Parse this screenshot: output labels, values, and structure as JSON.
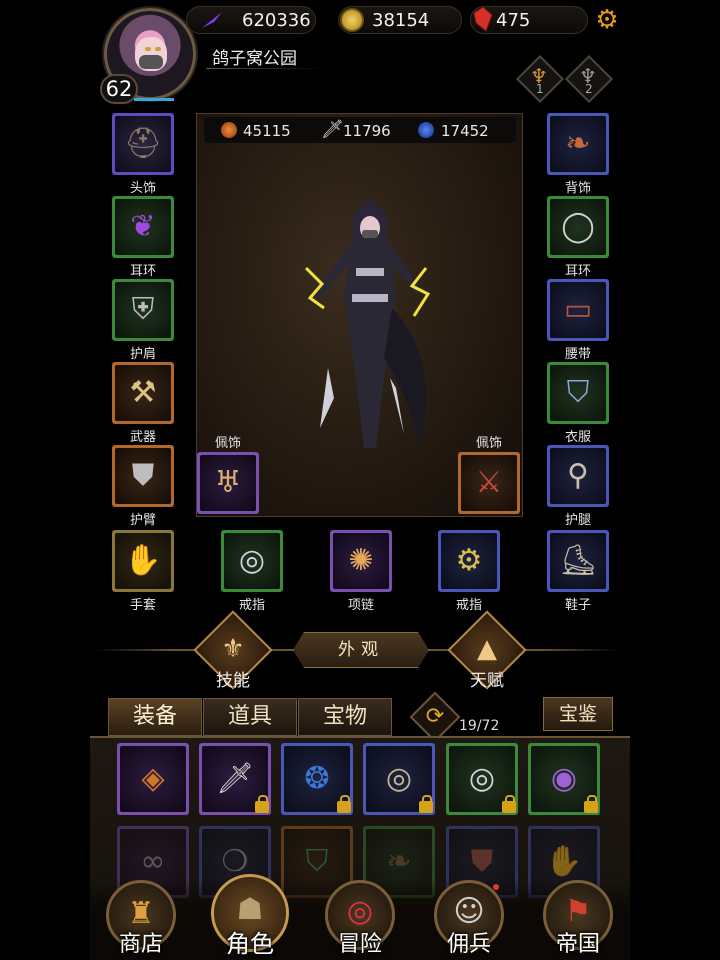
{
  "player": {
    "level": "62",
    "location": "鸽子窝公园"
  },
  "resources": [
    {
      "name": "power",
      "icon": "purple-blade-icon",
      "value": "620336",
      "color": "#8a3cf0"
    },
    {
      "name": "coin",
      "icon": "gold-coin-icon",
      "value": "38154",
      "color": "#d6a21a"
    },
    {
      "name": "gem",
      "icon": "red-crystal-icon",
      "value": "475",
      "color": "#d6302a"
    }
  ],
  "ranks": [
    {
      "label": "1",
      "color": "#d69a2a"
    },
    {
      "label": "2",
      "color": "#8a8a8a"
    }
  ],
  "stats": [
    {
      "icon": "orange-orb-icon",
      "value": "45115",
      "color": "#d8641e"
    },
    {
      "icon": "sword-icon",
      "value": "11796",
      "color": "#cfcfcf"
    },
    {
      "icon": "blue-orb-icon",
      "value": "17452",
      "color": "#2a62e0"
    }
  ],
  "equipment_left": [
    {
      "label": "头饰",
      "icon": "hood-icon",
      "glyph": "⛑",
      "rarity": "purple"
    },
    {
      "label": "耳环",
      "icon": "ribbon-earring-icon",
      "glyph": "❦",
      "rarity": "green"
    },
    {
      "label": "护肩",
      "icon": "shoulder-armor-icon",
      "glyph": "⛨",
      "rarity": "green"
    },
    {
      "label": "武器",
      "icon": "axe-icon",
      "glyph": "⚒",
      "rarity": "orange"
    },
    {
      "label": "护臂",
      "icon": "bracer-icon",
      "glyph": "⛊",
      "rarity": "orange"
    }
  ],
  "equipment_right": [
    {
      "label": "背饰",
      "icon": "cape-icon",
      "glyph": "❧",
      "rarity": "blue"
    },
    {
      "label": "耳环",
      "icon": "ring-earring-icon",
      "glyph": "◯",
      "rarity": "green"
    },
    {
      "label": "腰带",
      "icon": "belt-icon",
      "glyph": "▭",
      "rarity": "blue"
    },
    {
      "label": "衣服",
      "icon": "chainmail-icon",
      "glyph": "⛉",
      "rarity": "green"
    },
    {
      "label": "护腿",
      "icon": "leg-armor-icon",
      "glyph": "⚲",
      "rarity": "blue"
    }
  ],
  "equipment_bottom": [
    {
      "label": "手套",
      "icon": "glove-icon",
      "glyph": "✋",
      "rarity": "gold"
    },
    {
      "label": "戒指",
      "icon": "ring-icon",
      "glyph": "💍",
      "rarity": "green"
    },
    {
      "label": "项链",
      "icon": "necklace-icon",
      "glyph": "✺",
      "rarity": "violet"
    },
    {
      "label": "戒指",
      "icon": "signet-ring-icon",
      "glyph": "⚙",
      "rarity": "blue"
    },
    {
      "label": "鞋子",
      "icon": "boots-icon",
      "glyph": "👢",
      "rarity": "blue"
    }
  ],
  "accessories": [
    {
      "label": "佩饰",
      "icon": "pendant-icon",
      "glyph": "♅",
      "rarity": "violet"
    },
    {
      "label": "佩饰",
      "icon": "crossed-swords-medal-icon",
      "glyph": "⚔",
      "rarity": "orange"
    }
  ],
  "actions": {
    "skill": "技能",
    "appearance": "外观",
    "talent": "天赋"
  },
  "inventory": {
    "tabs": [
      "装备",
      "道具",
      "宝物"
    ],
    "active_tab": 0,
    "count": "19/72",
    "guide": "宝鉴",
    "items_row1": [
      {
        "icon": "amulet-icon",
        "glyph": "◈",
        "rarity": "violet",
        "locked": false
      },
      {
        "icon": "dagger-icon",
        "glyph": "🗡",
        "rarity": "violet",
        "locked": true
      },
      {
        "icon": "blue-pendant-icon",
        "glyph": "❂",
        "rarity": "blue",
        "locked": true
      },
      {
        "icon": "bronze-ring-icon",
        "glyph": "◎",
        "rarity": "blue",
        "locked": true
      },
      {
        "icon": "silver-ring-icon",
        "glyph": "◎",
        "rarity": "green",
        "locked": true
      },
      {
        "icon": "amethyst-ring-icon",
        "glyph": "◉",
        "rarity": "green",
        "locked": true
      }
    ],
    "items_row2": [
      {
        "icon": "chain-icon",
        "glyph": "∞",
        "rarity": "violet"
      },
      {
        "icon": "bead-necklace-icon",
        "glyph": "❍",
        "rarity": "blue"
      },
      {
        "icon": "green-armor-icon",
        "glyph": "⛉",
        "rarity": "orange"
      },
      {
        "icon": "cloak-icon",
        "glyph": "❧",
        "rarity": "green"
      },
      {
        "icon": "bracer-icon",
        "glyph": "⛊",
        "rarity": "blue"
      },
      {
        "icon": "gauntlet-icon",
        "glyph": "✋",
        "rarity": "blue"
      }
    ]
  },
  "nav": [
    {
      "label": "商店",
      "icon": "shop-icon",
      "glyph": "🏰",
      "active": false,
      "dot": false
    },
    {
      "label": "角色",
      "icon": "hooded-character-icon",
      "glyph": "☗",
      "active": true,
      "dot": false
    },
    {
      "label": "冒险",
      "icon": "portal-icon",
      "glyph": "◎",
      "active": false,
      "dot": false
    },
    {
      "label": "佣兵",
      "icon": "mercenary-icon",
      "glyph": "☺",
      "active": false,
      "dot": true
    },
    {
      "label": "帝国",
      "icon": "banner-icon",
      "glyph": "⚑",
      "active": false,
      "dot": false
    }
  ]
}
